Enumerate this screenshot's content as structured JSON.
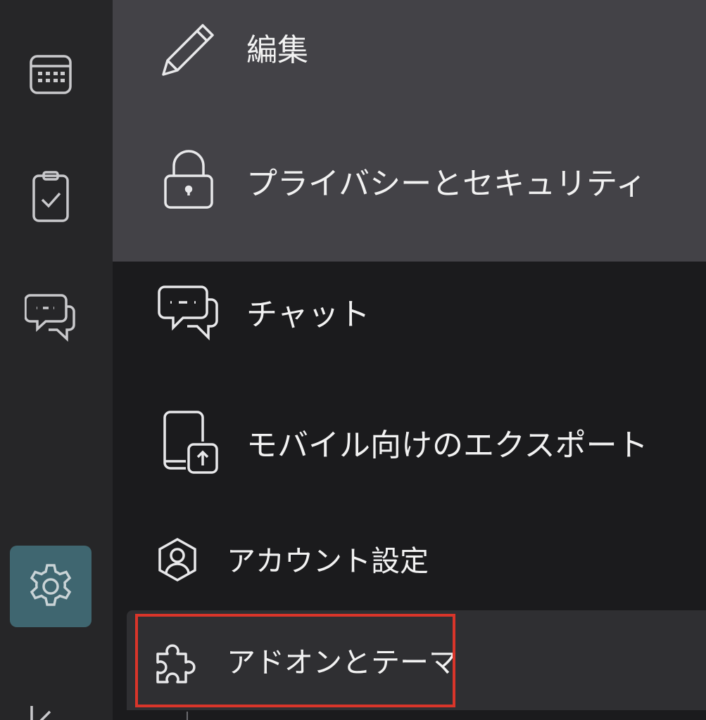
{
  "rail": {
    "items": [
      {
        "icon": "calendar-icon",
        "active": false
      },
      {
        "icon": "tasks-icon",
        "active": false
      },
      {
        "icon": "chat-icon",
        "active": false
      },
      {
        "icon": "settings-gear-icon",
        "active": true
      },
      {
        "icon": "collapse-icon",
        "active": false
      }
    ],
    "active_color": "#3f6670"
  },
  "menu": {
    "edit": {
      "label": "編集",
      "icon": "pencil-icon"
    },
    "privacy": {
      "label": "プライバシーとセキュリティ",
      "icon": "lock-icon"
    },
    "chat": {
      "label": "チャット",
      "icon": "chat-bubbles-icon"
    },
    "mobile_export": {
      "label": "モバイル向けのエクスポート",
      "icon": "mobile-export-icon"
    },
    "account": {
      "label": "アカウント設定",
      "icon": "account-icon"
    },
    "addons": {
      "label": "アドオンとテーマ",
      "icon": "puzzle-icon",
      "selected": true
    }
  },
  "colors": {
    "upper_block_bg": "#434247",
    "panel_bg": "#1b1b1d",
    "rail_bg": "#262628",
    "highlight_border": "#d9352a"
  }
}
